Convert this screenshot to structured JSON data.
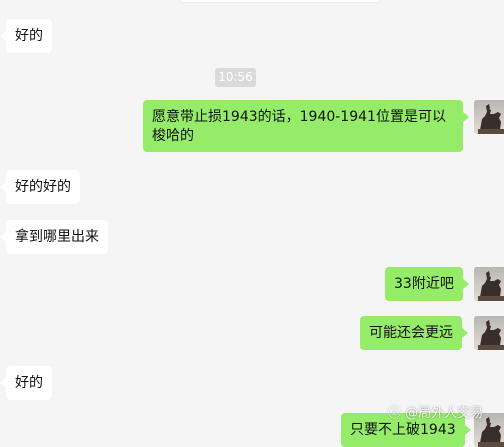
{
  "timestamp": "10:56",
  "messages": [
    {
      "id": "m1",
      "direction": "in",
      "text": "好的"
    },
    {
      "id": "m2",
      "direction": "out",
      "text": "愿意带止损1943的话，1940-1941位置是可以梭哈的"
    },
    {
      "id": "m3",
      "direction": "in",
      "text": "好的好的"
    },
    {
      "id": "m4",
      "direction": "in",
      "text": "拿到哪里出来"
    },
    {
      "id": "m5",
      "direction": "out",
      "text": "33附近吧"
    },
    {
      "id": "m6",
      "direction": "out",
      "text": "可能还会更远"
    },
    {
      "id": "m7",
      "direction": "in",
      "text": "好的"
    },
    {
      "id": "m8",
      "direction": "out",
      "text": "只要不上破1943"
    }
  ],
  "watermark": "@局外人交易",
  "colors": {
    "background": "#f5f5f5",
    "incoming_bubble": "#ffffff",
    "outgoing_bubble": "#95ec69",
    "timestamp_bg": "#dadada"
  },
  "icons": {
    "avatar": "equestrian-statue-avatar",
    "watermark_logo": "zhihu-logo"
  }
}
